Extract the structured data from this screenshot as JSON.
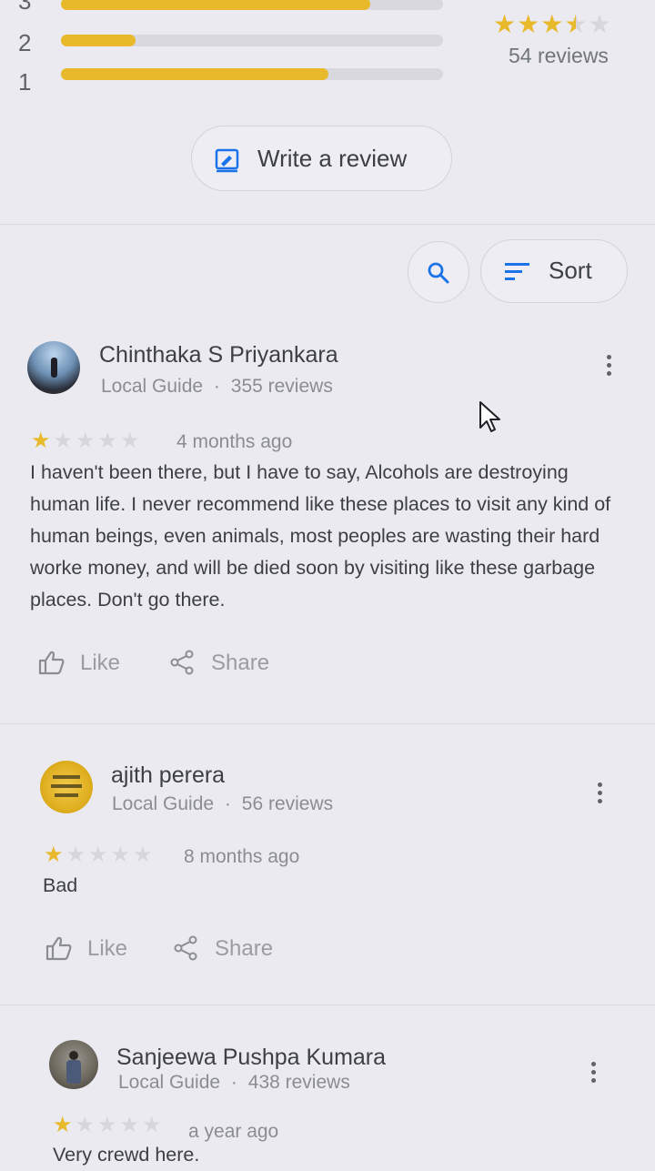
{
  "rating_breakdown": {
    "rows": [
      {
        "label": "3",
        "fill": 0.8
      },
      {
        "label": "2",
        "fill": 0.2
      },
      {
        "label": "1",
        "fill": 0.7
      }
    ]
  },
  "summary": {
    "stars": 3.5,
    "reviews_count": "54 reviews"
  },
  "write_review": {
    "label": "Write a review"
  },
  "toolbar": {
    "sort_label": "Sort"
  },
  "reviews": [
    {
      "name": "Chinthaka S Priyankara",
      "badge": "Local Guide",
      "count": "355 reviews",
      "stars": 1,
      "ago": "4 months ago",
      "text": "I haven't been there, but I have to say, Alcohols are destroying human life. I never recommend like these places to visit any kind of human beings, even animals, most peoples are wasting their hard worke money, and will be died soon by visiting like these garbage places. Don't go there."
    },
    {
      "name": "ajith perera",
      "badge": "Local Guide",
      "count": "56 reviews",
      "stars": 1,
      "ago": "8 months ago",
      "text": "Bad"
    },
    {
      "name": "Sanjeewa Pushpa Kumara",
      "badge": "Local Guide",
      "count": "438 reviews",
      "stars": 1,
      "ago": "a year ago",
      "text": "Very crewd here."
    }
  ],
  "actions": {
    "like": "Like",
    "share": "Share"
  },
  "colors": {
    "star": "#e7b92b",
    "accent": "#1a73e8"
  },
  "icons": [
    "write-review-icon",
    "search-icon",
    "sort-icon",
    "more-vert-icon",
    "thumb-up-icon",
    "share-icon",
    "mouse-cursor-icon"
  ]
}
